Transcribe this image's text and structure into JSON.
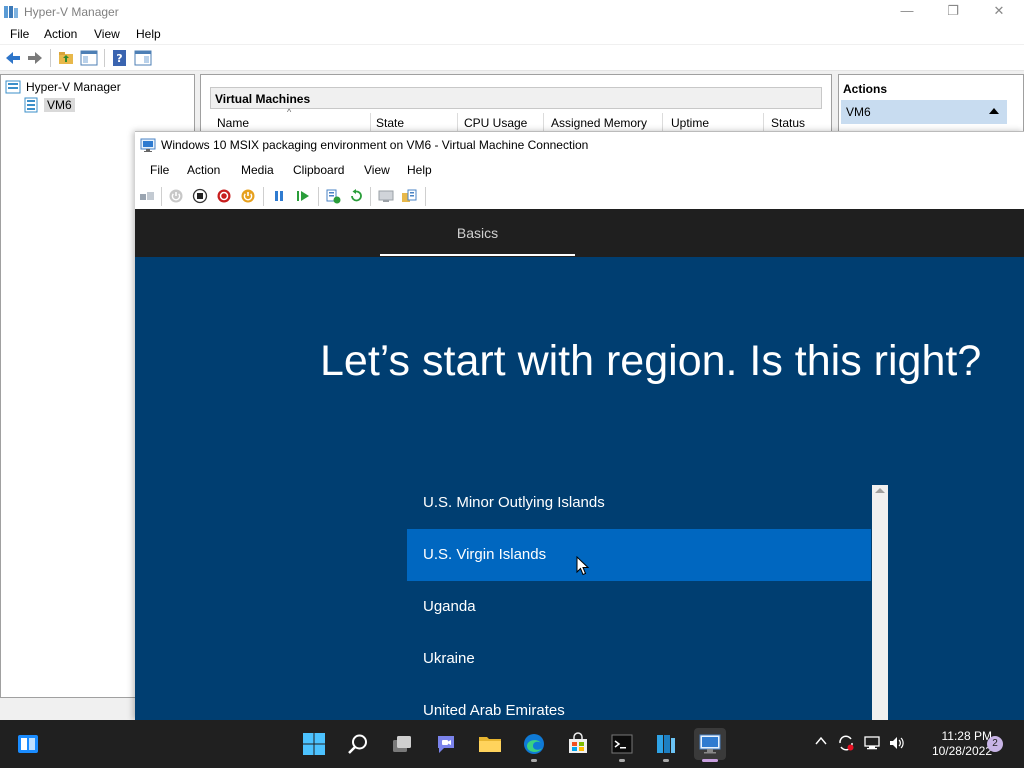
{
  "hv": {
    "title": "Hyper-V Manager",
    "menu": [
      "File",
      "Action",
      "View",
      "Help"
    ],
    "tree": {
      "root": "Hyper-V Manager",
      "child": "VM6"
    },
    "vm_pane": {
      "title": "Virtual Machines",
      "columns": [
        "Name",
        "State",
        "CPU Usage",
        "Assigned Memory",
        "Uptime",
        "Status"
      ]
    },
    "actions": {
      "title": "Actions",
      "vm": "VM6"
    },
    "window_controls": {
      "minimize": "—",
      "restore": "❐",
      "close": "✕"
    }
  },
  "vmc": {
    "title": "Windows 10 MSIX packaging environment on VM6 - Virtual Machine Connection",
    "menu": [
      "File",
      "Action",
      "Media",
      "Clipboard",
      "View",
      "Help"
    ]
  },
  "oobe": {
    "tab": "Basics",
    "heading": "Let’s start with region. Is this right?",
    "regions": [
      "U.S. Minor Outlying Islands",
      "U.S. Virgin Islands",
      "Uganda",
      "Ukraine",
      "United Arab Emirates"
    ],
    "selected_index": 1
  },
  "taskbar": {
    "time": "11:28 PM",
    "date": "10/28/2022",
    "notifications": "2",
    "tray_icons": [
      "chevron-up-icon",
      "sync-icon",
      "network-icon",
      "volume-icon"
    ]
  },
  "colors": {
    "oobe_bg": "#003e71",
    "oobe_top": "#1f1f1f",
    "selection": "#0067c0",
    "taskbar": "#202020"
  }
}
